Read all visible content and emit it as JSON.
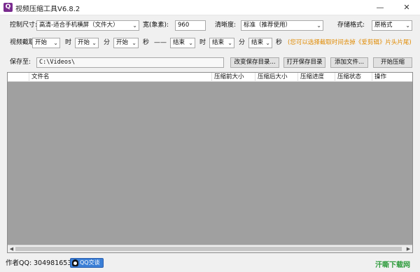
{
  "window": {
    "title": "视频压缩工具V6.8.2",
    "icon_letter": "Q",
    "minimize": "—",
    "close": "✕"
  },
  "row1": {
    "control_size_label": "控制尺寸:",
    "control_size_value": "高清-适合手机横屏（文件大）",
    "width_label": "宽(象素):",
    "width_value": "960",
    "clarity_label": "清晰度:",
    "clarity_value": "标准（推荐使用）",
    "format_label": "存储格式:",
    "format_value": "原格式"
  },
  "row2": {
    "clip_label": "视频截取:",
    "start_hour": "开始",
    "hour_unit": "时",
    "start_min": "开始",
    "min_unit": "分",
    "start_sec": "开始",
    "sec_unit": "秒",
    "dash": "——",
    "end_hour": "结束",
    "hour_unit2": "时",
    "end_min": "结束",
    "min_unit2": "分",
    "end_sec": "结束",
    "sec_unit2": "秒",
    "hint": "(您可以选择截取时间去掉《爱剪辑》片头片尾)"
  },
  "row3": {
    "save_label": "保存至:",
    "save_path": "C:\\Videos\\",
    "change_dir_btn": "改变保存目录...",
    "open_dir_btn": "打开保存目录",
    "add_file_btn": "添加文件...",
    "start_btn": "开始压缩"
  },
  "table": {
    "columns": [
      "文件名",
      "压缩前大小",
      "压缩后大小",
      "压缩进度",
      "压缩状态",
      "操作"
    ],
    "rows": []
  },
  "footer": {
    "author_label": "作者QQ:",
    "qq_number": "3049816538",
    "qq_badge": "QQ交谈",
    "watermark": "汗嘶下载网"
  },
  "colors": {
    "hint": "#e08a00",
    "table_bg": "#a0a0a0",
    "icon": "#7a2c8f"
  }
}
